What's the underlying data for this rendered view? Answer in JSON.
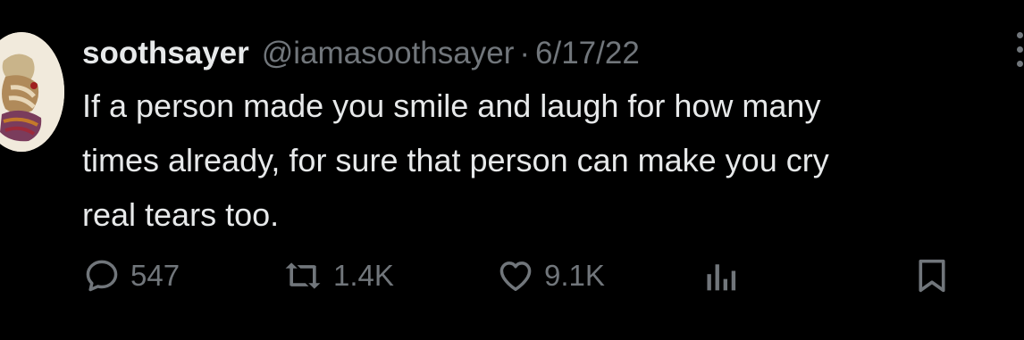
{
  "tweet": {
    "display_name": "soothsayer",
    "handle": "@iamasoothsayer",
    "separator": "·",
    "date": "6/17/22",
    "text": "If a person made you smile and laugh for how many\ntimes already, for sure that person can make you cry\nreal tears too."
  },
  "actions": {
    "reply_icon": "reply-icon",
    "reply_count": "547",
    "retweet_icon": "retweet-icon",
    "retweet_count": "1.4K",
    "like_icon": "heart-icon",
    "like_count": "9.1K",
    "views_icon": "bar-chart-icon",
    "bookmark_icon": "bookmark-icon"
  },
  "colors": {
    "background": "#000000",
    "primary_text": "#e7e9ea",
    "secondary_text": "#71767b"
  }
}
